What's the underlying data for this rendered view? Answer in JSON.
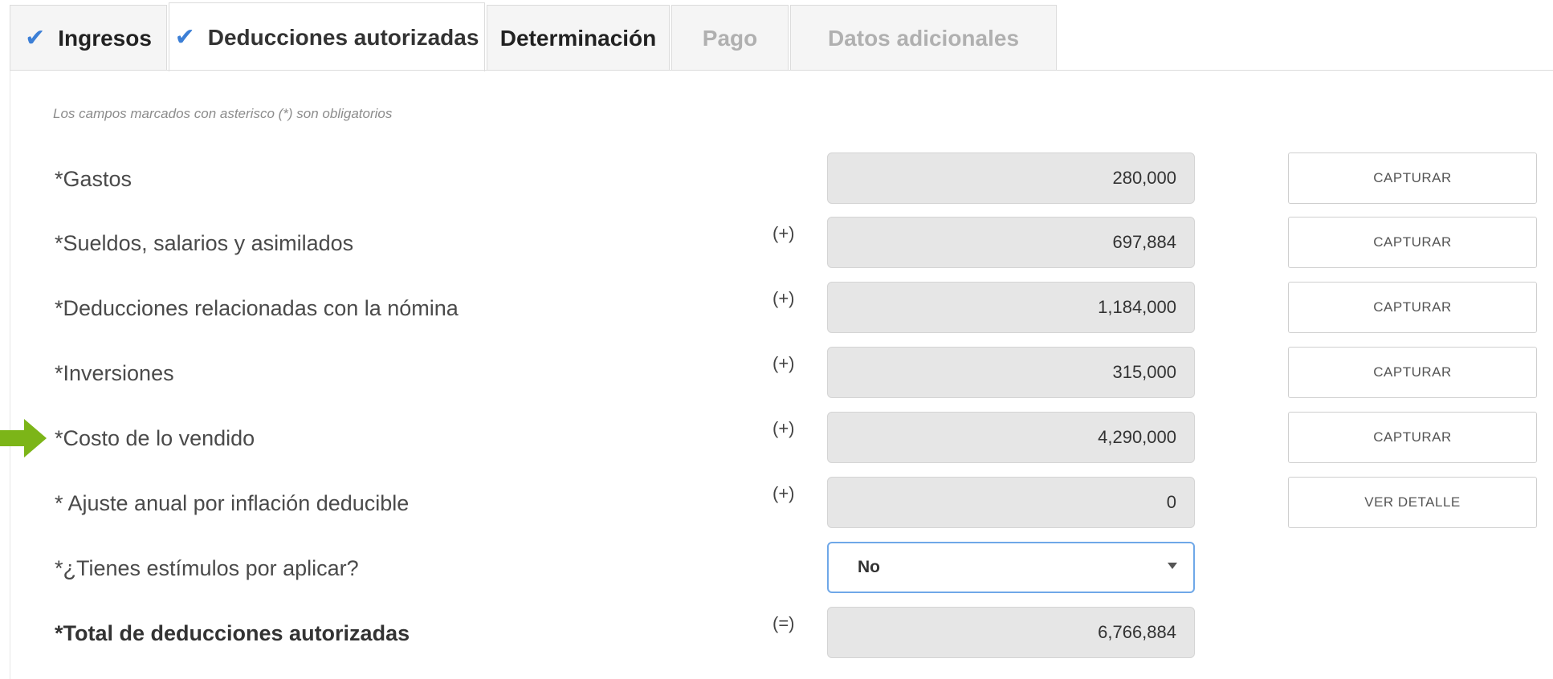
{
  "tabs": [
    {
      "label": "Ingresos",
      "checked": true,
      "state": "normal"
    },
    {
      "label": "Deducciones autorizadas",
      "checked": true,
      "state": "active"
    },
    {
      "label": "Determinación",
      "checked": false,
      "state": "normal"
    },
    {
      "label": "Pago",
      "checked": false,
      "state": "disabled"
    },
    {
      "label": "Datos adicionales",
      "checked": false,
      "state": "disabled"
    }
  ],
  "check_glyph": "✔",
  "note": "Los campos marcados con asterisco (*) son obligatorios",
  "rows": {
    "gastos": {
      "label": "*Gastos",
      "value": "280,000",
      "button": "CAPTURAR"
    },
    "sueldos": {
      "label": "*Sueldos, salarios y asimilados",
      "op": "(+)",
      "value": "697,884",
      "button": "CAPTURAR"
    },
    "nomina": {
      "label": "*Deducciones relacionadas con la nómina",
      "op": "(+)",
      "value": "1,184,000",
      "button": "CAPTURAR"
    },
    "inversiones": {
      "label": "*Inversiones",
      "op": "(+)",
      "value": "315,000",
      "button": "CAPTURAR"
    },
    "costo": {
      "label": "*Costo de lo vendido",
      "op": "(+)",
      "value": "4,290,000",
      "button": "CAPTURAR"
    },
    "ajuste": {
      "label": "* Ajuste anual por inflación deducible",
      "op": "(+)",
      "value": "0",
      "button": "VER DETALLE"
    },
    "estimulos": {
      "label": "*¿Tienes estímulos por aplicar?",
      "selected": "No"
    },
    "total": {
      "label": "*Total de deducciones autorizadas",
      "op": "(=)",
      "value": "6,766,884"
    }
  },
  "colors": {
    "accent": "#3c7fd6",
    "arrow": "#7cb518",
    "field_bg": "#e6e6e6",
    "select_border": "#6fa8e8"
  },
  "icons": {
    "pointer": "green-arrow-icon",
    "check": "check-icon",
    "dropdown": "caret-down-icon"
  }
}
